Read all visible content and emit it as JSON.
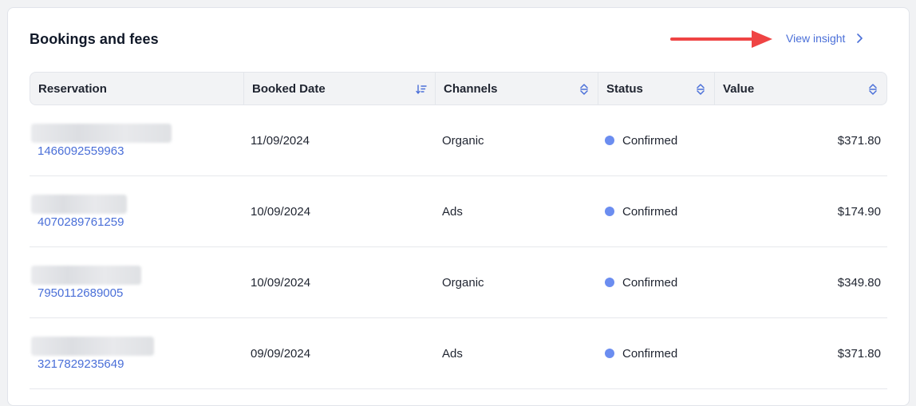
{
  "card": {
    "title": "Bookings and fees",
    "view_insight_label": "View insight"
  },
  "colors": {
    "accent": "#4a6fd8",
    "status_confirmed": "#6b8df0",
    "annotation_arrow": "#ef4444"
  },
  "table": {
    "columns": [
      {
        "label": "Reservation",
        "sort_icon": "none"
      },
      {
        "label": "Booked Date",
        "sort_icon": "sort-descending-icon"
      },
      {
        "label": "Channels",
        "sort_icon": "sort-updown-icon"
      },
      {
        "label": "Status",
        "sort_icon": "sort-updown-icon"
      },
      {
        "label": "Value",
        "sort_icon": "sort-updown-icon"
      }
    ],
    "rows": [
      {
        "reservation_id": "1466092559963",
        "booked_date": "11/09/2024",
        "channel": "Organic",
        "status": "Confirmed",
        "value": "$371.80"
      },
      {
        "reservation_id": "4070289761259",
        "booked_date": "10/09/2024",
        "channel": "Ads",
        "status": "Confirmed",
        "value": "$174.90"
      },
      {
        "reservation_id": "7950112689005",
        "booked_date": "10/09/2024",
        "channel": "Organic",
        "status": "Confirmed",
        "value": "$349.80"
      },
      {
        "reservation_id": "3217829235649",
        "booked_date": "09/09/2024",
        "channel": "Ads",
        "status": "Confirmed",
        "value": "$371.80"
      }
    ]
  }
}
